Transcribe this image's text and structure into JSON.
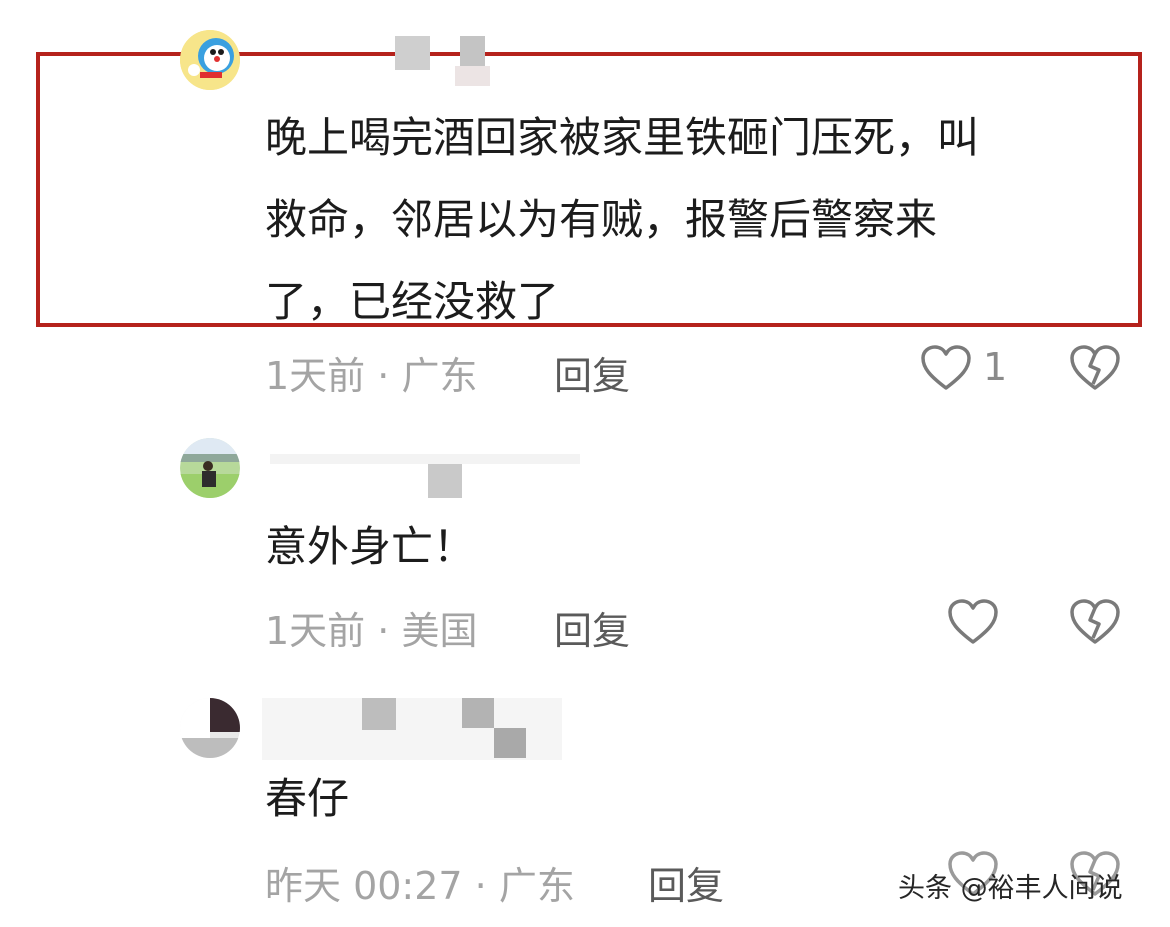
{
  "comments": [
    {
      "text_lines": [
        "晚上喝完酒回家被家里铁砸门压死，叫",
        "救命，邻居以为有贼，报警后警察来",
        "了，已经没救了"
      ],
      "time": "1天前",
      "location": "广东",
      "reply_label": "回复",
      "like_count": "1"
    },
    {
      "text_lines": [
        "意外身亡！"
      ],
      "time": "1天前",
      "location": "美国",
      "reply_label": "回复",
      "like_count": ""
    },
    {
      "text_lines": [
        "春仔"
      ],
      "time": "昨天 00:27",
      "location": "广东",
      "reply_label": "回复",
      "like_count": ""
    }
  ],
  "separator": " · ",
  "watermark": "头条 @裕丰人间说",
  "colors": {
    "highlight": "#b5221c",
    "meta": "#a4a4a4",
    "text": "#1c1c1c"
  }
}
